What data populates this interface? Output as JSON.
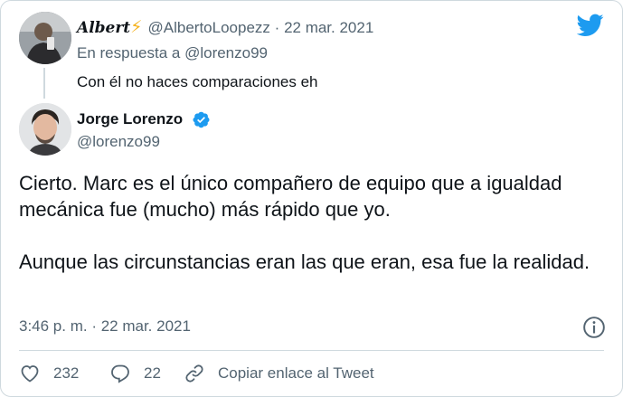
{
  "reply": {
    "name": "Albert",
    "emoji": "⚡",
    "handle": "@AlbertoLoopezz",
    "separator": "·",
    "date": "22 mar. 2021",
    "in_reply_to": "En respuesta a @lorenzo99",
    "text": "Con él no haces comparaciones eh"
  },
  "tweet": {
    "name": "Jorge Lorenzo",
    "handle": "@lorenzo99",
    "paragraphs": [
      "Cierto. Marc es el único compañero de equipo que a igualdad mecánica fue (mucho) más rápido que yo.",
      "Aunque las circunstancias eran las que eran, esa fue la realidad."
    ],
    "timestamp": "3:46 p. m. · 22 mar. 2021"
  },
  "actions": {
    "likes": "232",
    "replies": "22",
    "copy_link": "Copiar enlace al Tweet"
  },
  "icons": {
    "brand": "twitter-bird-icon",
    "verified": "verified-badge-icon",
    "info": "info-icon",
    "like": "heart-icon",
    "reply": "speech-bubble-icon",
    "copy": "link-icon"
  },
  "colors": {
    "twitter_blue": "#1d9bf0",
    "text": "#0f1419",
    "secondary": "#536471",
    "border": "#cfd9de",
    "bolt": "#f5b21b"
  }
}
